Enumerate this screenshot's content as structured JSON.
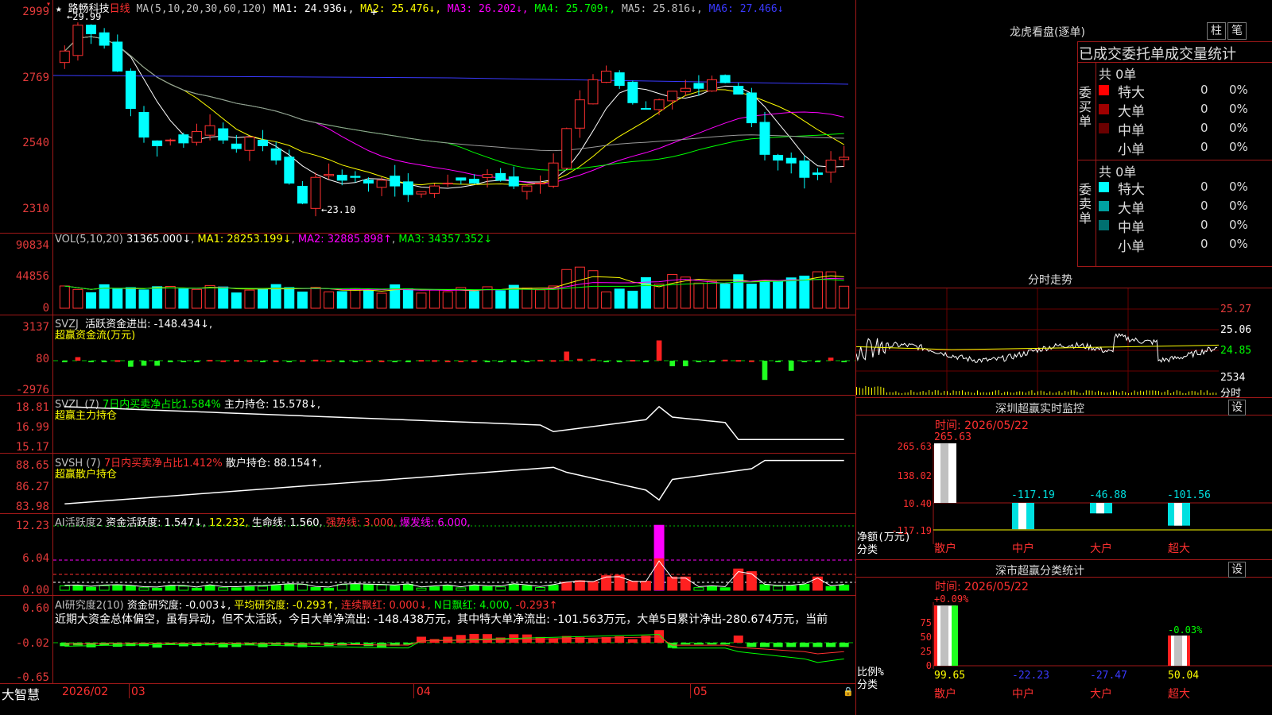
{
  "stock": {
    "star": "★",
    "name": "路畅科技",
    "period": "日线"
  },
  "ma_header": {
    "params": "MA(5,10,20,30,60,120)",
    "items": [
      {
        "label": "MA1: 24.936↓",
        "color": "#ffffff"
      },
      {
        "label": "MA2: 25.476↓",
        "color": "#ffff00"
      },
      {
        "label": "MA3: 26.202↓",
        "color": "#ff00ff"
      },
      {
        "label": "MA4: 25.709↑",
        "color": "#00ff00"
      },
      {
        "label": "MA5: 25.816↓",
        "color": "#c0c0c0"
      },
      {
        "label": "MA6: 27.466↓",
        "color": "#3a3aff"
      }
    ],
    "cross": "+"
  },
  "price_axis": [
    "2999",
    "2769",
    "2540",
    "2310"
  ],
  "price_annotations": {
    "high": "29.99",
    "low": "23.10"
  },
  "vol": {
    "header": "VOL(5,10,20)",
    "value": "31365.000↓",
    "ma1": "MA1: 28253.199↓",
    "ma2": "MA2: 32885.898↑",
    "ma3": "MA3: 34357.352↓",
    "axis": [
      "90834",
      "44856",
      "0"
    ]
  },
  "svzj": {
    "name": "SVZJ",
    "label": "活跃资金进出: -148.434↓,",
    "sub": "超赢资金流(万元)",
    "axis": [
      "3137",
      "80",
      "-2976"
    ]
  },
  "svzl": {
    "name": "SVZL (7)",
    "label1": "7日内买卖净占比1.584%",
    "label2": "主力持仓: 15.578↓,",
    "sub": "超赢主力持仓",
    "axis": [
      "18.81",
      "16.99",
      "15.17"
    ]
  },
  "svsh": {
    "name": "SVSH (7)",
    "label1": "7日内买卖净占比1.412%",
    "label2": "散户持仓: 88.154↑,",
    "sub": "超赢散户持仓",
    "axis": [
      "88.65",
      "86.27",
      "83.98"
    ]
  },
  "ai1": {
    "name": "AI活跃度2",
    "l1": "资金活跃度: 1.547↓,",
    "l2": "12.232,",
    "l3": "生命线: 1.560,",
    "l4": "强势线: 3.000,",
    "l5": "爆发线: 6.000,",
    "axis": [
      "12.23",
      "6.04",
      "0.00"
    ]
  },
  "ai2": {
    "name": "AI研究度2(10)",
    "l1": "资金研究度: -0.003↓,",
    "l2": "平均研究度: -0.293↑,",
    "l3": "连续飘红: 0.000↓,",
    "l4": "N日飘红: 4.000,",
    "l5": "-0.293↑",
    "text": "近期大资金总体偏空，虽有异动，但不太活跃，今日大单净流出: -148.438万元，其中特大单净流出: -101.563万元，大单5日累计净出-280.674万元，当前",
    "axis": [
      "0.60",
      "-0.02",
      "-0.65"
    ]
  },
  "date_axis": {
    "brand": "大智慧",
    "labels": [
      "2026/02",
      "03",
      "04",
      "05"
    ]
  },
  "right": {
    "lhb": {
      "title": "龙虎看盘(逐单)",
      "btn1": "柱",
      "btn2": "笔",
      "header": "已成交委托单成交量统计",
      "buy": {
        "side": "委买单",
        "total": "共 0单",
        "rows": [
          {
            "name": "特大",
            "color": "#ff0000",
            "v": "0",
            "p": "0%"
          },
          {
            "name": "大单",
            "color": "#a00000",
            "v": "0",
            "p": "0%"
          },
          {
            "name": "中单",
            "color": "#6a0000",
            "v": "0",
            "p": "0%"
          },
          {
            "name": "小单",
            "color": "#000000",
            "v": "0",
            "p": "0%"
          }
        ]
      },
      "sell": {
        "side": "委卖单",
        "total": "共 0单",
        "rows": [
          {
            "name": "特大",
            "color": "#00ffff",
            "v": "0",
            "p": "0%"
          },
          {
            "name": "大单",
            "color": "#00a0a0",
            "v": "0",
            "p": "0%"
          },
          {
            "name": "中单",
            "color": "#007070",
            "v": "0",
            "p": "0%"
          },
          {
            "name": "小单",
            "color": "#000000",
            "v": "0",
            "p": "0%"
          }
        ]
      }
    },
    "fs": {
      "title": "分时走势",
      "axis": [
        "25.27",
        "25.06",
        "24.85",
        "2534",
        "分时"
      ]
    },
    "sz": {
      "title": "深圳超赢实时监控",
      "btn": "设",
      "time": "时间: 2026/05/22",
      "axis": [
        "265.63",
        "138.02",
        "10.40",
        "-117.19"
      ],
      "ylabel": "净额(万元)",
      "xlabel": "分类",
      "cats": [
        "散户",
        "中户",
        "大户",
        "超大"
      ],
      "values": [
        "265.63",
        "-117.19",
        "-46.88",
        "-101.56"
      ]
    },
    "fl": {
      "title": "深市超赢分类统计",
      "btn": "设",
      "time": "时间: 2026/05/22",
      "axis": [
        "75",
        "50",
        "25",
        "0"
      ],
      "ylabel": "比例%",
      "xlabel": "分类",
      "top": [
        "+0.09%",
        "-0.03%"
      ],
      "cats": [
        "散户",
        "中户",
        "大户",
        "超大"
      ],
      "values": [
        "99.65",
        "-22.23",
        "-27.47",
        "50.04"
      ]
    }
  }
}
